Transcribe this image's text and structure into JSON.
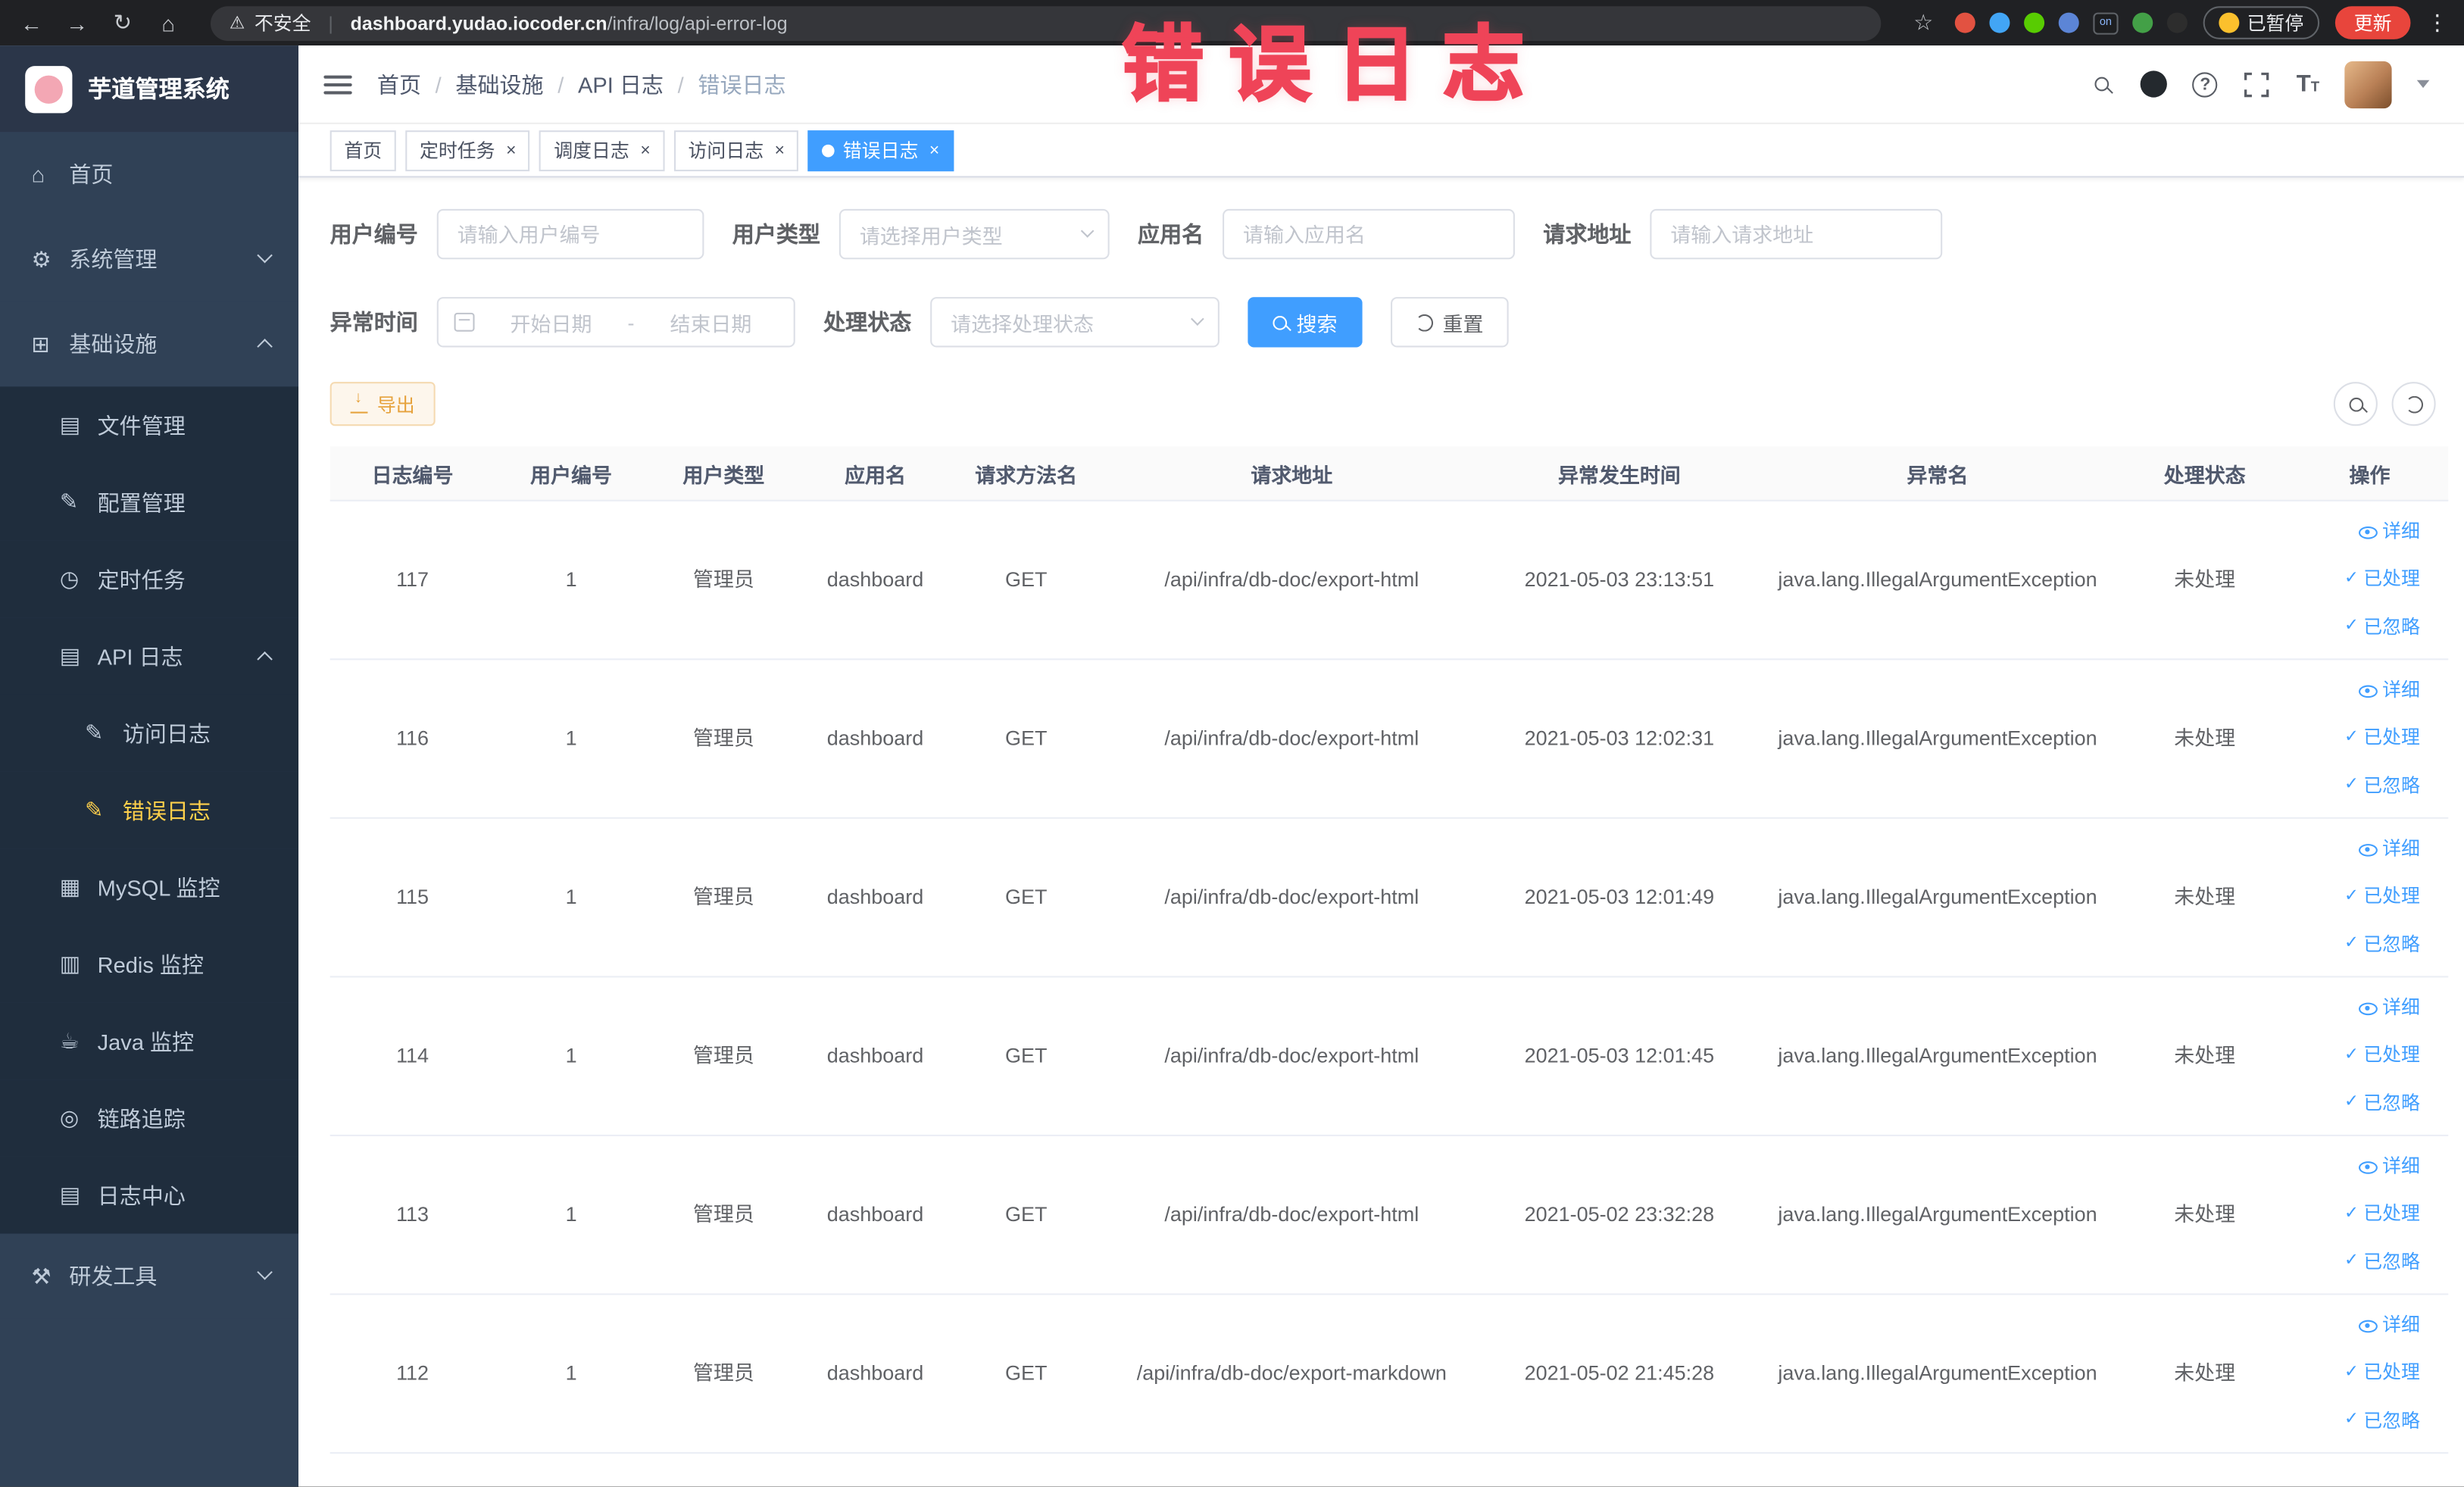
{
  "browser": {
    "security_label": "不安全",
    "url_separator": "|",
    "url_domain": "dashboard.yudao.iocoder.cn",
    "url_path": "/infra/log/api-error-log",
    "extensions": [
      {
        "type": "dot",
        "color": "#e25241"
      },
      {
        "type": "dot",
        "color": "#42a5f5"
      },
      {
        "type": "dot",
        "color": "#58cc02"
      },
      {
        "type": "dot",
        "color": "#5c85d6"
      },
      {
        "type": "badge",
        "label": "on",
        "color": "#202124"
      },
      {
        "type": "dot",
        "color": "#43a047"
      },
      {
        "type": "dot",
        "color": "#2d2d2d"
      }
    ],
    "paused_badge": "已暂停",
    "update_button": "更新"
  },
  "annotation": {
    "text": "错误日志",
    "color": "#ef4458"
  },
  "sidebar": {
    "logo_title": "芋道管理系统",
    "items": [
      {
        "id": "home",
        "label": "首页",
        "icon": "dashboard-icon",
        "level": 1
      },
      {
        "id": "system",
        "label": "系统管理",
        "icon": "gear-icon",
        "level": 1,
        "chevron": "down"
      },
      {
        "id": "infra",
        "label": "基础设施",
        "icon": "monitor-icon",
        "level": 1,
        "chevron": "up"
      },
      {
        "id": "file",
        "label": "文件管理",
        "icon": "folder-icon",
        "level": 2
      },
      {
        "id": "config",
        "label": "配置管理",
        "icon": "edit-icon",
        "level": 2
      },
      {
        "id": "job",
        "label": "定时任务",
        "icon": "clock-icon",
        "level": 2
      },
      {
        "id": "api-log",
        "label": "API 日志",
        "icon": "document-icon",
        "level": 2,
        "chevron": "up"
      },
      {
        "id": "access-log",
        "label": "访问日志",
        "icon": "edit-icon",
        "level": 3
      },
      {
        "id": "error-log",
        "label": "错误日志",
        "icon": "edit-icon",
        "level": 3,
        "active": true
      },
      {
        "id": "mysql",
        "label": "MySQL 监控",
        "icon": "grid-icon",
        "level": 2
      },
      {
        "id": "redis",
        "label": "Redis 监控",
        "icon": "database-icon",
        "level": 2
      },
      {
        "id": "java",
        "label": "Java 监控",
        "icon": "coffee-icon",
        "level": 2
      },
      {
        "id": "tracing",
        "label": "链路追踪",
        "icon": "target-icon",
        "level": 2
      },
      {
        "id": "log-center",
        "label": "日志中心",
        "icon": "document-icon",
        "level": 2
      },
      {
        "id": "dev-tools",
        "label": "研发工具",
        "icon": "tools-icon",
        "level": 1,
        "chevron": "down"
      }
    ]
  },
  "navbar": {
    "breadcrumb_separator": "/",
    "breadcrumb": [
      {
        "label": "首页"
      },
      {
        "label": "基础设施"
      },
      {
        "label": "API 日志"
      },
      {
        "label": "错误日志"
      }
    ]
  },
  "tabs": {
    "close_glyph": "×",
    "items": [
      {
        "id": "home",
        "label": "首页"
      },
      {
        "id": "job",
        "label": "定时任务",
        "closable": true
      },
      {
        "id": "job-log",
        "label": "调度日志",
        "closable": true
      },
      {
        "id": "access-log",
        "label": "访问日志",
        "closable": true
      },
      {
        "id": "error-log",
        "label": "错误日志",
        "closable": true,
        "active": true
      }
    ]
  },
  "filters": {
    "user_id_label": "用户编号",
    "user_id_placeholder": "请输入用户编号",
    "user_type_label": "用户类型",
    "user_type_placeholder": "请选择用户类型",
    "app_name_label": "应用名",
    "app_name_placeholder": "请输入应用名",
    "request_url_label": "请求地址",
    "request_url_placeholder": "请输入请求地址",
    "exception_time_label": "异常时间",
    "start_date_placeholder": "开始日期",
    "range_separator": "-",
    "end_date_placeholder": "结束日期",
    "process_status_label": "处理状态",
    "process_status_placeholder": "请选择处理状态",
    "search_button": "搜索",
    "reset_button": "重置"
  },
  "toolbar": {
    "export_button": "导出"
  },
  "table": {
    "columns": [
      "日志编号",
      "用户编号",
      "用户类型",
      "应用名",
      "请求方法名",
      "请求地址",
      "异常发生时间",
      "异常名",
      "处理状态",
      "操作"
    ],
    "actions": [
      "详细",
      "已处理",
      "已忽略"
    ],
    "rows": [
      {
        "id": "117",
        "user_id": "1",
        "user_type": "管理员",
        "app": "dashboard",
        "method": "GET",
        "url": "/api/infra/db-doc/export-html",
        "time": "2021-05-03 23:13:51",
        "exception": "java.lang.IllegalArgumentException",
        "status": "未处理"
      },
      {
        "id": "116",
        "user_id": "1",
        "user_type": "管理员",
        "app": "dashboard",
        "method": "GET",
        "url": "/api/infra/db-doc/export-html",
        "time": "2021-05-03 12:02:31",
        "exception": "java.lang.IllegalArgumentException",
        "status": "未处理"
      },
      {
        "id": "115",
        "user_id": "1",
        "user_type": "管理员",
        "app": "dashboard",
        "method": "GET",
        "url": "/api/infra/db-doc/export-html",
        "time": "2021-05-03 12:01:49",
        "exception": "java.lang.IllegalArgumentException",
        "status": "未处理"
      },
      {
        "id": "114",
        "user_id": "1",
        "user_type": "管理员",
        "app": "dashboard",
        "method": "GET",
        "url": "/api/infra/db-doc/export-html",
        "time": "2021-05-03 12:01:45",
        "exception": "java.lang.IllegalArgumentException",
        "status": "未处理"
      },
      {
        "id": "113",
        "user_id": "1",
        "user_type": "管理员",
        "app": "dashboard",
        "method": "GET",
        "url": "/api/infra/db-doc/export-html",
        "time": "2021-05-02 23:32:28",
        "exception": "java.lang.IllegalArgumentException",
        "status": "未处理"
      },
      {
        "id": "112",
        "user_id": "1",
        "user_type": "管理员",
        "app": "dashboard",
        "method": "GET",
        "url": "/api/infra/db-doc/export-markdown",
        "time": "2021-05-02 21:45:28",
        "exception": "java.lang.IllegalArgumentException",
        "status": "未处理"
      }
    ]
  }
}
